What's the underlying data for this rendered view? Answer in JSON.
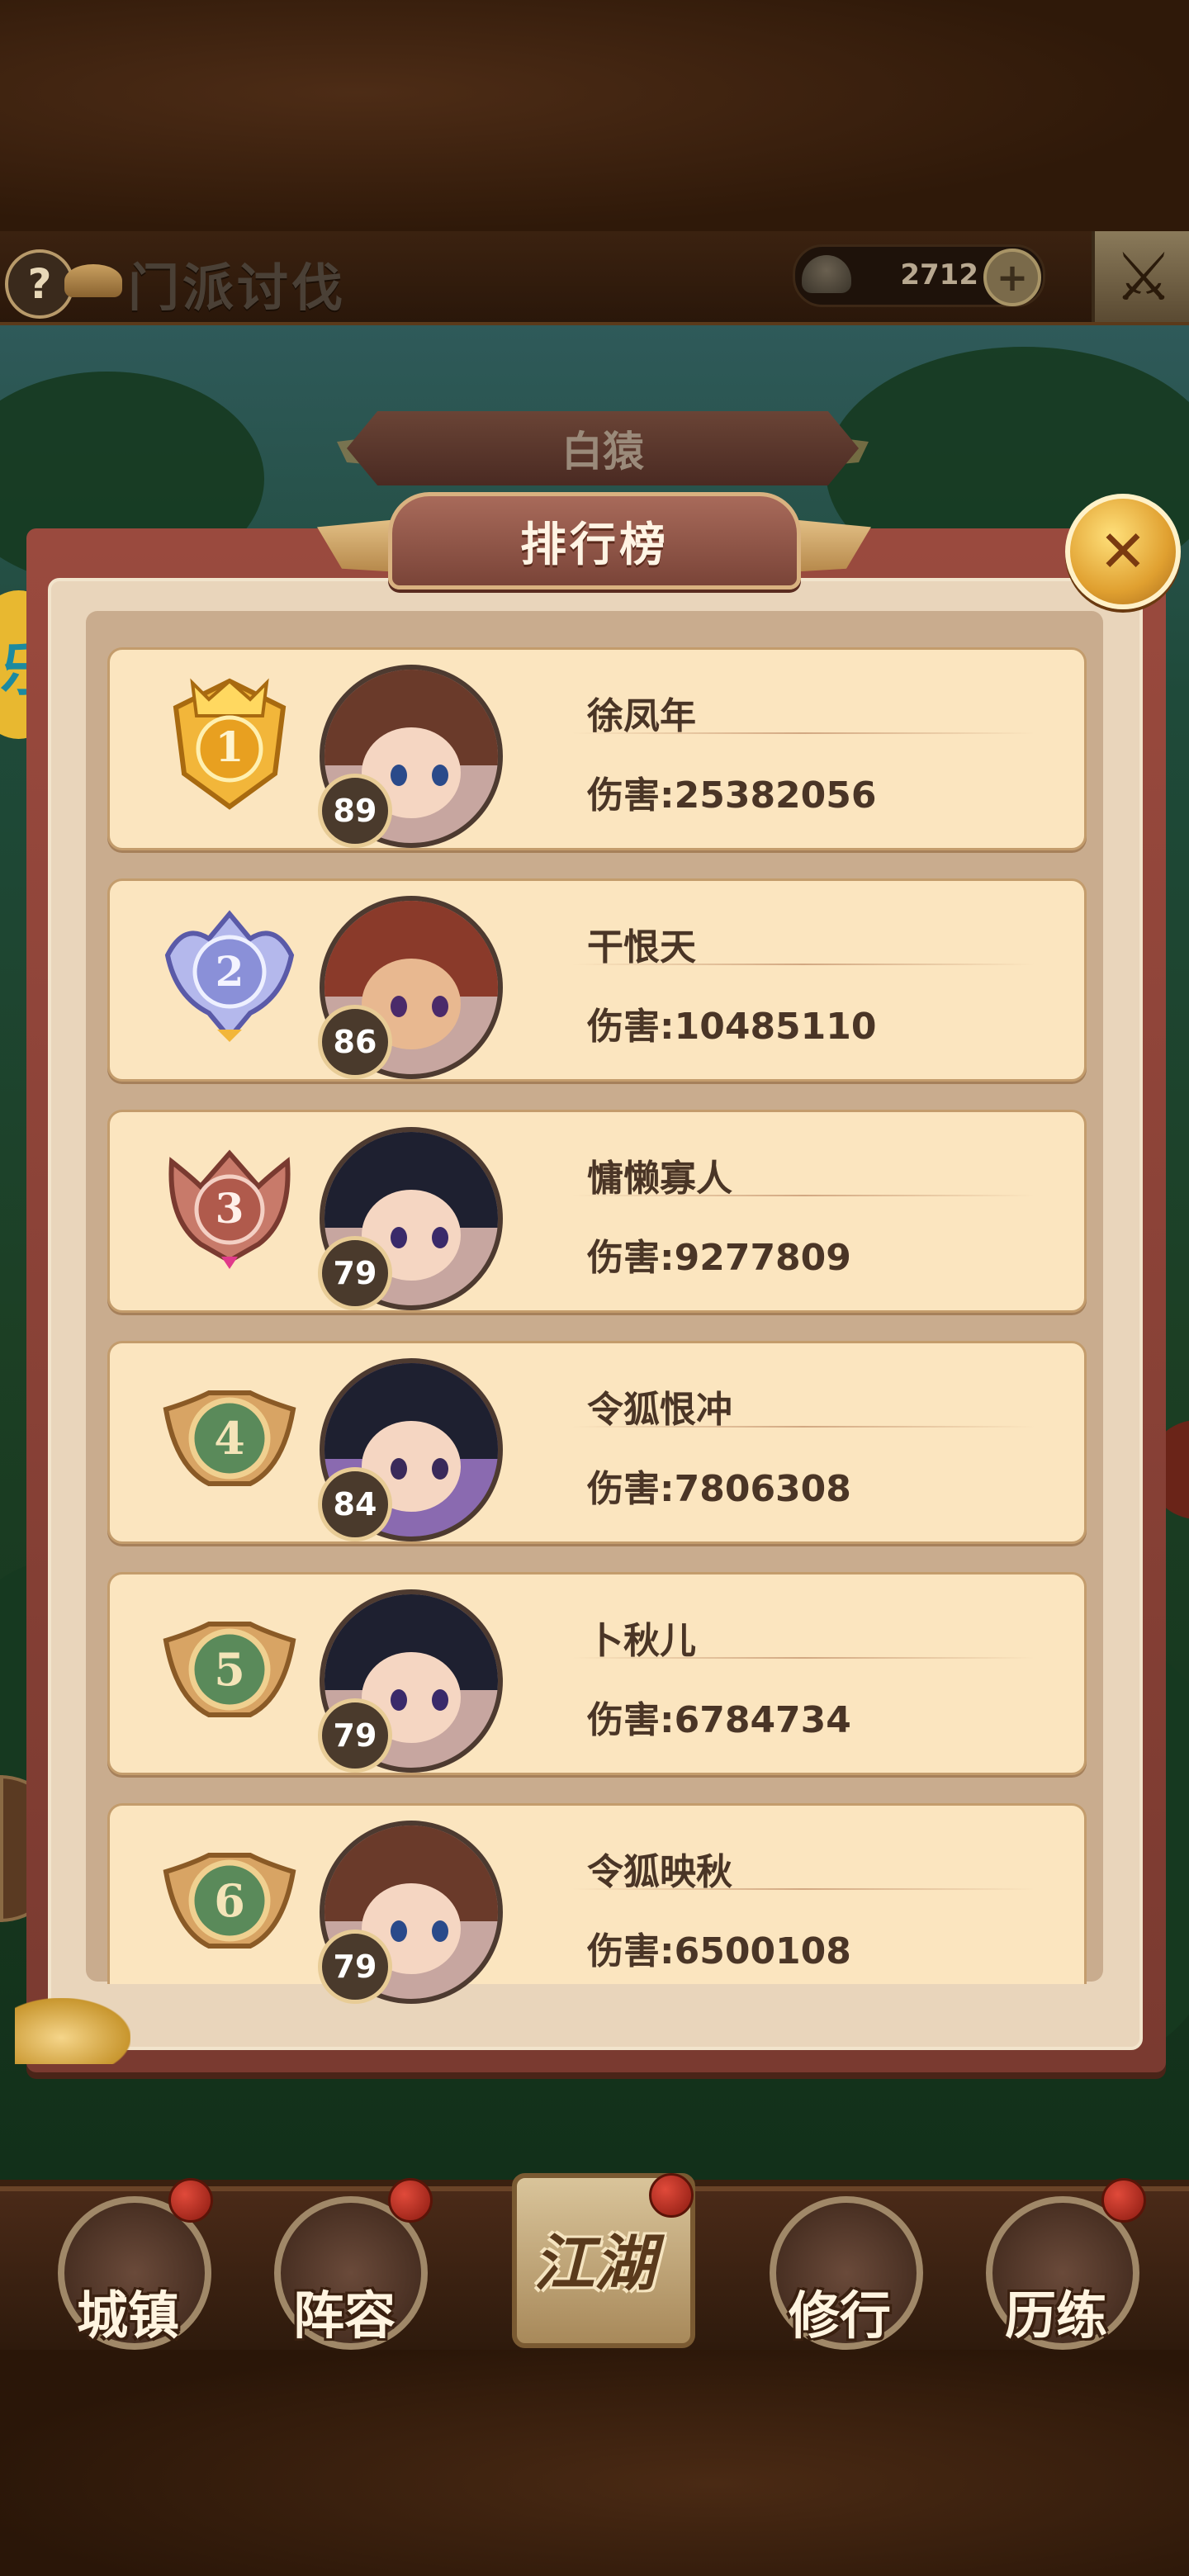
{
  "header": {
    "help_icon": "?",
    "title": "门派讨伐",
    "currency_icon": "gold-ingot-icon",
    "currency_value": "2712",
    "plus_label": "+",
    "close_icon": "crossed-swords-icon"
  },
  "boss_banner": {
    "name": "白猿"
  },
  "side_badge": {
    "text": "乐"
  },
  "dialog": {
    "title": "排行榜",
    "close_icon": "crossed-swords-icon"
  },
  "ranking": [
    {
      "rank": "1",
      "medal": "gold",
      "level": "89",
      "name": "徐凤年",
      "damage": "伤害:25382056"
    },
    {
      "rank": "2",
      "medal": "silver",
      "level": "86",
      "name": "干恨天",
      "damage": "伤害:10485110"
    },
    {
      "rank": "3",
      "medal": "bronze",
      "level": "79",
      "name": "慵懒寡人",
      "damage": "伤害:9277809"
    },
    {
      "rank": "4",
      "medal": "plain",
      "level": "84",
      "name": "令狐恨冲",
      "damage": "伤害:7806308"
    },
    {
      "rank": "5",
      "medal": "plain",
      "level": "79",
      "name": "卜秋儿",
      "damage": "伤害:6784734"
    },
    {
      "rank": "6",
      "medal": "plain",
      "level": "79",
      "name": "令狐映秋",
      "damage": "伤害:6500108"
    }
  ],
  "bottom_nav": [
    {
      "label": "城镇",
      "icon": "town-icon"
    },
    {
      "label": "阵容",
      "icon": "lineup-icon"
    },
    {
      "label": "江湖",
      "icon": "jianghu-scroll-icon"
    },
    {
      "label": "修行",
      "icon": "cultivation-icon"
    },
    {
      "label": "历练",
      "icon": "training-icon"
    }
  ],
  "colors": {
    "row_bg": "#fbe5bf",
    "frame": "#8a3e34",
    "gold": "#e8b830",
    "silver": "#9aa0e0",
    "bronze": "#c06a60",
    "plain_medal": "#c8965a"
  }
}
